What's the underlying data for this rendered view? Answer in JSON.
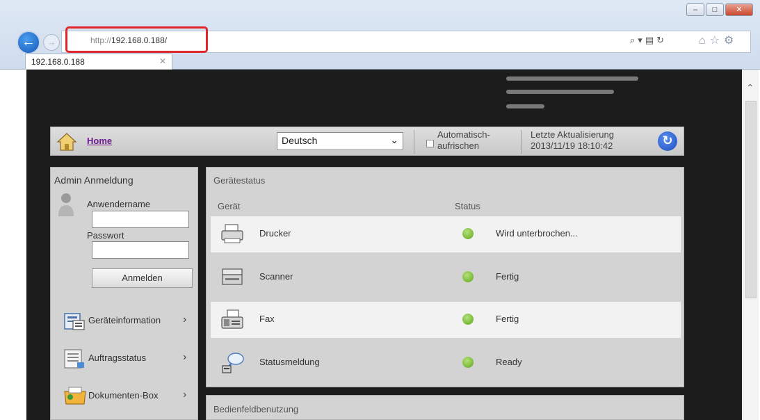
{
  "browser": {
    "url_prefix": "http://",
    "url_host": "192.168.0.188/",
    "tab_title": "192.168.0.188",
    "tab_close": "✕",
    "highlight_color": "#e0262b"
  },
  "toolbar": {
    "home_label": "Home",
    "language": "Deutsch",
    "auto_refresh_label": "Automatisch-aufrischen",
    "last_update_label": "Letzte Aktualisierung",
    "last_update_time": "2013/11/19 18:10:42"
  },
  "login": {
    "title": "Admin Anmeldung",
    "username_label": "Anwendername",
    "password_label": "Passwort",
    "login_button": "Anmelden"
  },
  "menu": [
    {
      "label": "Geräteinformation",
      "icon": "device-info-icon"
    },
    {
      "label": "Auftragsstatus",
      "icon": "job-status-icon"
    },
    {
      "label": "Dokumenten-Box",
      "icon": "document-box-icon"
    }
  ],
  "status": {
    "title": "Gerätestatus",
    "col_device": "Gerät",
    "col_status": "Status",
    "rows": [
      {
        "device": "Drucker",
        "state": "Wird unterbrochen...",
        "icon": "printer-icon"
      },
      {
        "device": "Scanner",
        "state": "Fertig",
        "icon": "scanner-icon"
      },
      {
        "device": "Fax",
        "state": "Fertig",
        "icon": "fax-icon"
      },
      {
        "device": "Statusmeldung",
        "state": "Ready",
        "icon": "status-message-icon"
      }
    ]
  },
  "panel2": {
    "title": "Bedienfeldbenutzung"
  },
  "colors": {
    "page_background": "#1c1c1c",
    "panel": "#d3d3d3",
    "ok_indicator": "#5fa81a",
    "home_link": "#6a1b8f"
  }
}
